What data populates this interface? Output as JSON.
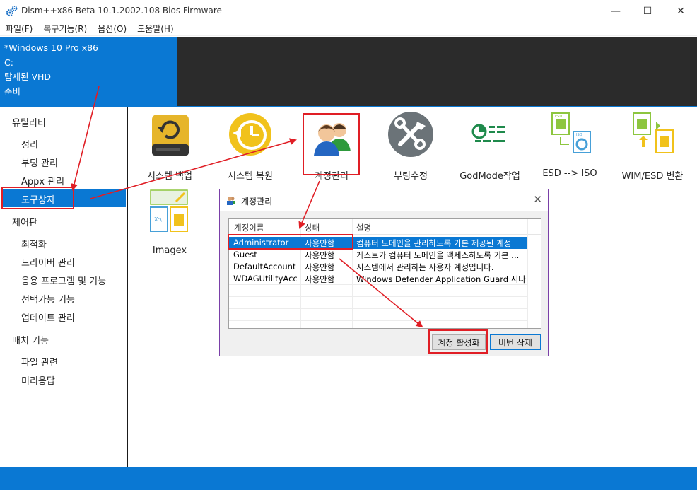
{
  "window": {
    "title": "Dism++x86 Beta 10.1.2002.108 Bios Firmware",
    "minimize": "—",
    "maximize": "☐",
    "close": "✕"
  },
  "menu": [
    "파일(F)",
    "복구기능(R)",
    "옵션(O)",
    "도움말(H)"
  ],
  "info": {
    "os": "*Windows 10 Pro x86",
    "drive": "C:",
    "mount": "탑재된 VHD",
    "status": "준비"
  },
  "sidebar": {
    "sections": [
      {
        "label": "유틸리티",
        "items": [
          "정리",
          "부팅 관리",
          "Appx 관리",
          "도구상자"
        ]
      },
      {
        "label": "제어판",
        "items": [
          "최적화",
          "드라이버 관리",
          "응용 프로그램 및 기능",
          "선택가능 기능",
          "업데이트 관리"
        ]
      },
      {
        "label": "배치 기능",
        "items": [
          "파일 관련",
          "미리응답"
        ]
      }
    ],
    "selected": "도구상자"
  },
  "tools": [
    {
      "label": "시스템 백업",
      "icon": "drive-backup-icon"
    },
    {
      "label": "시스템 복원",
      "icon": "clock-restore-icon"
    },
    {
      "label": "계정관리",
      "icon": "users-icon"
    },
    {
      "label": "부팅수정",
      "icon": "wrench-screwdriver-icon"
    },
    {
      "label": "GodMode작업",
      "icon": "settings-list-icon"
    },
    {
      "label": "ESD --> ISO",
      "icon": "esd-iso-icon"
    },
    {
      "label": "WIM/ESD 변환",
      "icon": "wim-esd-convert-icon"
    },
    {
      "label": "Imagex",
      "icon": "imagex-icon"
    }
  ],
  "dialog": {
    "title": "계정관리",
    "close": "✕",
    "columns": [
      "계정이름",
      "상태",
      "설명"
    ],
    "rows": [
      {
        "name": "Administrator",
        "state": "사용안함",
        "desc": "컴퓨터 도메인을 관리하도록 기본 제공된 계정",
        "selected": true
      },
      {
        "name": "Guest",
        "state": "사용안함",
        "desc": "게스트가 컴퓨터 도메인을 액세스하도록 기본 ...",
        "selected": false
      },
      {
        "name": "DefaultAccount",
        "state": "사용안함",
        "desc": "시스템에서 관리하는 사용자 계정입니다.",
        "selected": false
      },
      {
        "name": "WDAGUtilityAcc...",
        "state": "사용안함",
        "desc": "Windows Defender Application Guard 시나리오...",
        "selected": false
      }
    ],
    "buttons": {
      "activate": "계정 활성화",
      "delete_password": "비번 삭제"
    }
  },
  "colors": {
    "accent": "#0a78d3",
    "highlight": "#e01e25",
    "dialog_border": "#7a3fa8"
  }
}
